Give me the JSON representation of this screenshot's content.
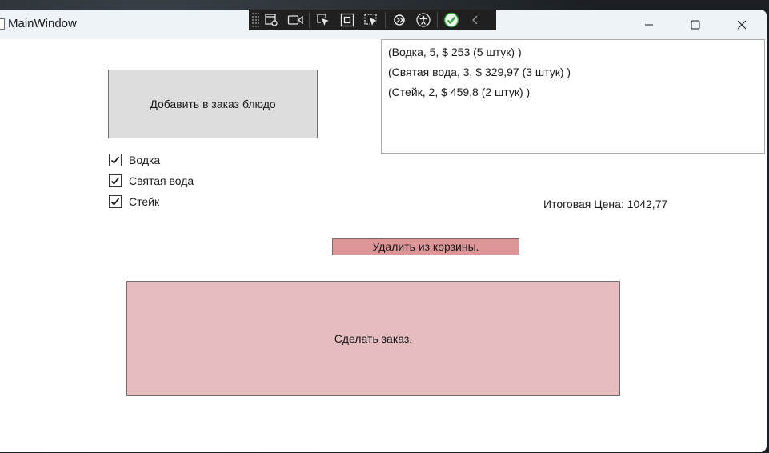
{
  "window": {
    "title": "MainWindow"
  },
  "debug_toolbar": {
    "icons": [
      "live-visual-tree-icon",
      "record-icon",
      "select-element-icon",
      "display-layout-adorners-icon",
      "track-focus-icon",
      "hot-reload-icon",
      "accessibility-icon",
      "binding-check-icon",
      "collapse-icon"
    ]
  },
  "main": {
    "add_button_label": "Добавить в заказ блюдо",
    "dishes": [
      {
        "label": "Водка",
        "checked": true
      },
      {
        "label": "Святая вода",
        "checked": true
      },
      {
        "label": "Стейк",
        "checked": true
      }
    ],
    "cart_items": [
      "(Водка, 5, $ 253 (5 штук) )",
      "(Святая вода, 3, $ 329,97 (3 штук) )",
      "(Стейк, 2, $ 459,8 (2 штук) )"
    ],
    "total_label": "Итоговая Цена: 1042,77",
    "remove_button_label": "Удалить из корзины.",
    "order_button_label": "Сделать заказ."
  },
  "colors": {
    "add_button_bg": "#dddddd",
    "remove_button_bg": "#de9597",
    "order_button_bg": "#e5bdbf"
  }
}
